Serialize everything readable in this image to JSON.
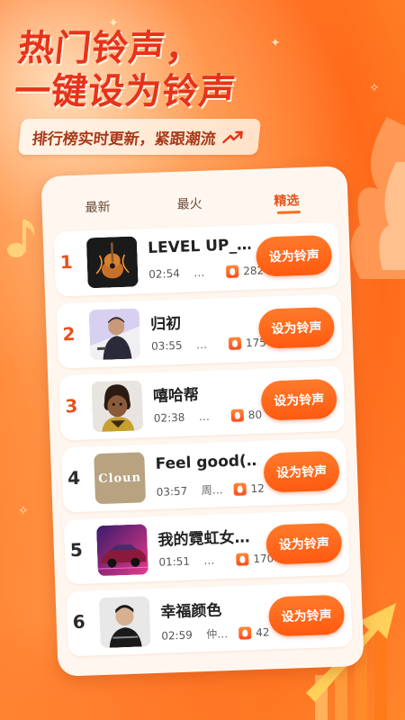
{
  "header": {
    "line1": "热门铃声，",
    "line2": "一键设为铃声",
    "subtitle": "排行榜实时更新，紧跟潮流"
  },
  "colors": {
    "accent": "#ff5a10",
    "headline": "#e8321a",
    "card": "#fff7ef"
  },
  "tabs": [
    {
      "label": "最新",
      "active": false
    },
    {
      "label": "最火",
      "active": false
    },
    {
      "label": "精选",
      "active": true
    }
  ],
  "ringtones": [
    {
      "rank": "1",
      "title": "LEVEL UP_…",
      "duration": "02:54",
      "artist": "…",
      "heat": "282",
      "button": "设为铃声",
      "cover": "guitar-cover"
    },
    {
      "rank": "2",
      "title": "归初",
      "duration": "03:55",
      "artist": "…",
      "heat": "175",
      "button": "设为铃声",
      "cover": "man-portrait-cover"
    },
    {
      "rank": "3",
      "title": "嘻哈帮",
      "duration": "02:38",
      "artist": "…",
      "heat": "80",
      "button": "设为铃声",
      "cover": "cartoon-character-cover"
    },
    {
      "rank": "4",
      "title": "Feel good(…",
      "duration": "03:57",
      "artist": "周…",
      "heat": "12",
      "button": "设为铃声",
      "cover": "cloun-logo-cover"
    },
    {
      "rank": "5",
      "title": "我的霓虹女…",
      "duration": "01:51",
      "artist": "…",
      "heat": "170",
      "button": "设为铃声",
      "cover": "neon-car-cover"
    },
    {
      "rank": "6",
      "title": "幸福颜色",
      "duration": "02:59",
      "artist": "仲…",
      "heat": "42",
      "button": "设为铃声",
      "cover": "singer-portrait-cover"
    }
  ],
  "cover_text": {
    "cloun": "Cloun"
  }
}
